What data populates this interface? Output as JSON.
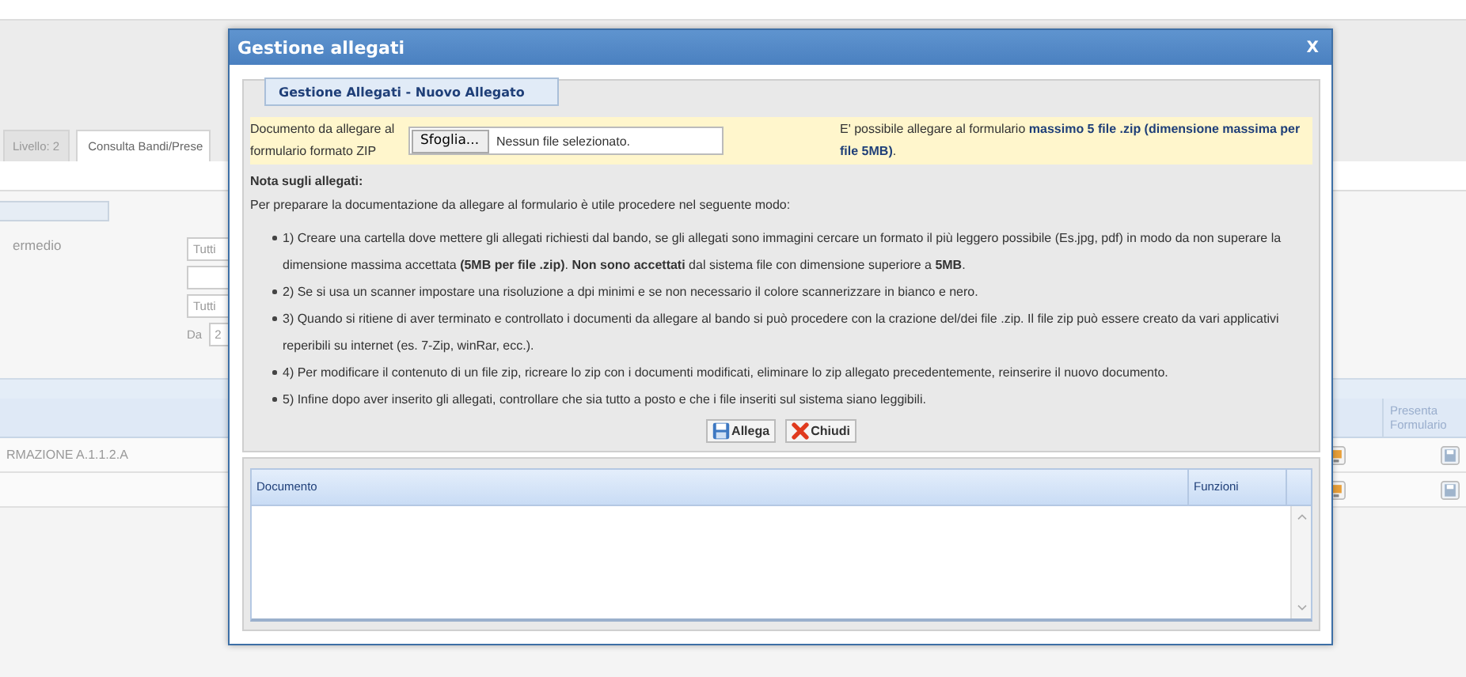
{
  "background": {
    "tabs": [
      {
        "label": "Livello: 2",
        "selected": false
      },
      {
        "label": "Consulta Bandi/Prese",
        "selected": true
      }
    ],
    "filters": {
      "label": "ermedio",
      "select_1": "Tutti",
      "select_2": "Tutti",
      "date_label": "Da",
      "date_value": "2"
    },
    "table": {
      "columns": [
        "Presenta Formulario"
      ],
      "rows": [
        {
          "column_1": "RMAZIONE A.1.1.2.A"
        },
        {}
      ]
    }
  },
  "dialog": {
    "title": "Gestione allegati",
    "close": "X",
    "legend": "Gestione Allegati - Nuovo Allegato",
    "file_label": "Documento da allegare al formulario formato ZIP",
    "browse_button": "Sfoglia...",
    "file_status": "Nessun file selezionato.",
    "limit_note": "E' possibile allegare al formulario **massimo 5 file .zip (dimensione massima per file 5MB)**.",
    "note_title": "Nota sugli allegati:",
    "note_intro": "Per preparare la documentazione da allegare al formulario è utile procedere nel seguente modo:",
    "steps": [
      "1) Creare una cartella dove mettere gli allegati richiesti dal bando, se gli allegati sono immagini cercare un formato il più leggero possibile (Es.jpg, pdf) in modo da non superare la dimensione massima accettata **(5MB per file .zip)**. **Non sono accettati** dal sistema file con dimensione superiore a **5MB**.",
      "2) Se si usa un scanner impostare una risoluzione a dpi minimi e se non necessario il colore scannerizzare in bianco e nero.",
      "3) Quando si ritiene di aver terminato e controllato i documenti da allegare al bando si può procedere con la crazione del/dei file .zip. Il file zip può essere creato da vari applicativi reperibili su internet (es. 7-Zip, winRar, ecc.).",
      "4) Per modificare il contenuto di un file zip, ricreare lo zip con i documenti modificati, eliminare lo zip allegato precedentemente, reinserire il nuovo documento.",
      "5) Infine dopo aver inserito gli allegati, controllare che sia tutto a posto e che i file inseriti sul sistema siano leggibili."
    ],
    "buttons": [
      {
        "label": "Allega",
        "kind": "save"
      },
      {
        "label": "Chiudi",
        "kind": "close"
      }
    ],
    "table": {
      "columns": [
        "Documento",
        "Funzioni"
      ]
    }
  }
}
